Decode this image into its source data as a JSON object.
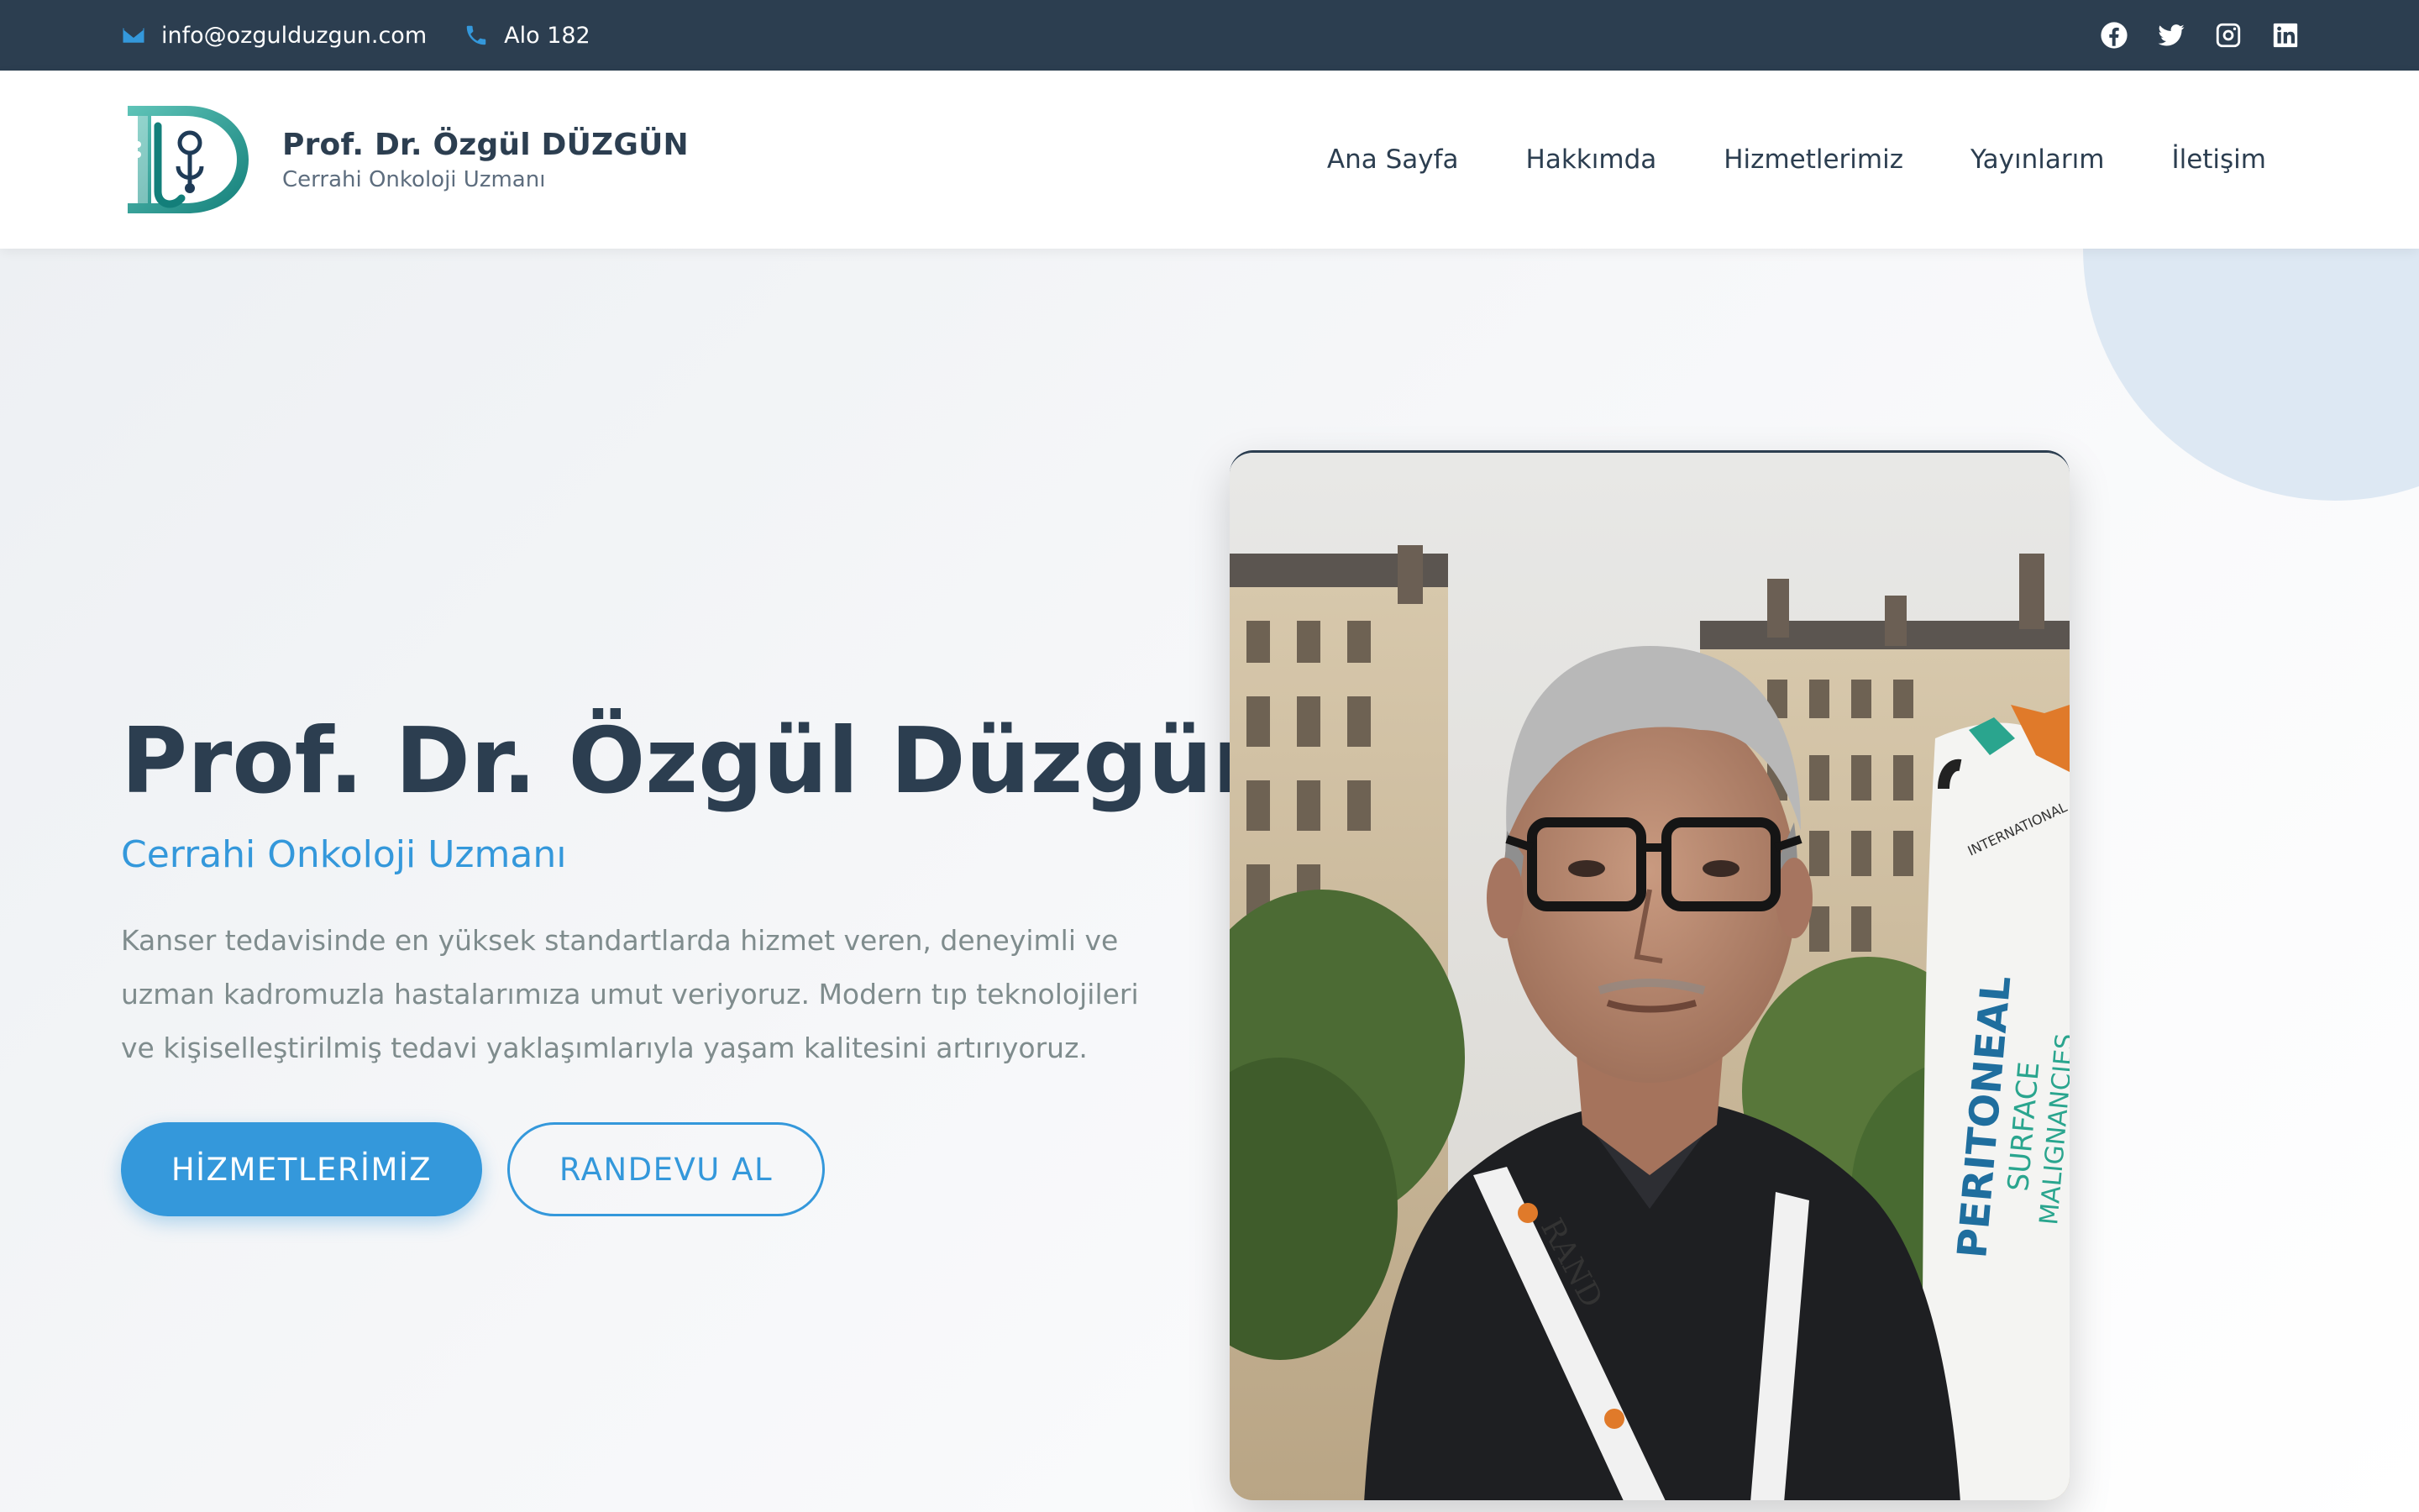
{
  "topbar": {
    "email": "info@ozgulduzgun.com",
    "phone": "Alo 182",
    "social": [
      "facebook-icon",
      "twitter-icon",
      "instagram-icon",
      "linkedin-icon"
    ]
  },
  "header": {
    "brand_title": "Prof. Dr. Özgül DÜZGÜN",
    "brand_subtitle": "Cerrahi Onkoloji Uzmanı",
    "nav": [
      "Ana Sayfa",
      "Hakkımda",
      "Hizmetlerimiz",
      "Yayınlarım",
      "İletişim"
    ]
  },
  "hero": {
    "title": "Prof. Dr. Özgül Düzgün",
    "subtitle": "Cerrahi Onkoloji Uzmanı",
    "description": "Kanser tedavisinde en yüksek standartlarda hizmet veren, deneyimli ve uzman kadromuzla hastalarımıza umut veriyoruz. Modern tıp teknolojileri ve kişiselleştirilmiş tedavi yaklaşımlarıyla yaşam kalitesini artırıyoruz.",
    "primary_button": "HİZMETLERİMİZ",
    "secondary_button": "RANDEVU AL"
  },
  "photo": {
    "banner_text": "PERITONEAL",
    "banner_sub": "SURFACE",
    "banner_sub2": "MALIGNANCIES",
    "banner_top": "INTERNATIONAL CONGRESS",
    "lanyard_text": "RAND"
  },
  "colors": {
    "primary": "#3498db",
    "dark": "#2c3e50",
    "muted": "#7f8c8d",
    "topbar_bg": "#2c3e50"
  }
}
